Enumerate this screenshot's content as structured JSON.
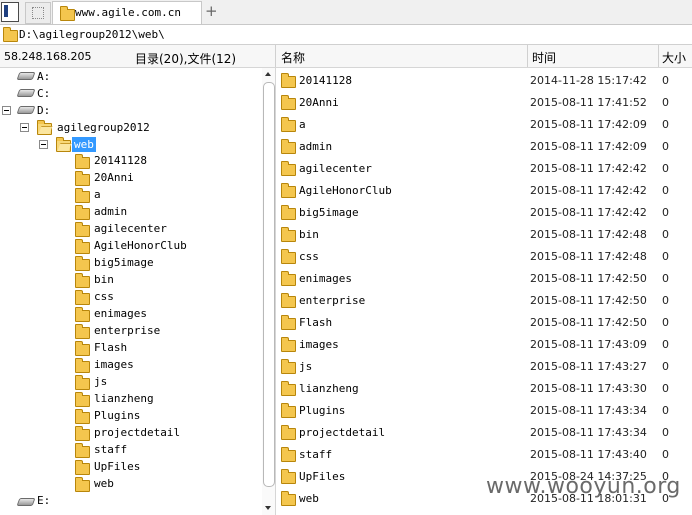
{
  "tabs": [
    {
      "label": "www.agile.com.cn"
    }
  ],
  "new_tab_label": "+",
  "path": "D:\\agilegroup2012\\web\\",
  "status": {
    "ip": "58.248.168.205",
    "summary": "目录(20),文件(12)"
  },
  "columns": {
    "name": "名称",
    "time": "时间",
    "size": "大小"
  },
  "tree": {
    "drives_top": [
      "A:",
      "C:",
      "D:"
    ],
    "agilegroup": "agilegroup2012",
    "web": "web",
    "children": [
      "20141128",
      "20Anni",
      "a",
      "admin",
      "agilecenter",
      "AgileHonorClub",
      "big5image",
      "bin",
      "css",
      "enimages",
      "enterprise",
      "Flash",
      "images",
      "js",
      "lianzheng",
      "Plugins",
      "projectdetail",
      "staff",
      "UpFiles",
      "web"
    ],
    "drive_e": "E:"
  },
  "files": [
    {
      "name": "20141128",
      "time": "2014-11-28 15:17:42",
      "size": "0"
    },
    {
      "name": "20Anni",
      "time": "2015-08-11 17:41:52",
      "size": "0"
    },
    {
      "name": "a",
      "time": "2015-08-11 17:42:09",
      "size": "0"
    },
    {
      "name": "admin",
      "time": "2015-08-11 17:42:09",
      "size": "0"
    },
    {
      "name": "agilecenter",
      "time": "2015-08-11 17:42:42",
      "size": "0"
    },
    {
      "name": "AgileHonorClub",
      "time": "2015-08-11 17:42:42",
      "size": "0"
    },
    {
      "name": "big5image",
      "time": "2015-08-11 17:42:42",
      "size": "0"
    },
    {
      "name": "bin",
      "time": "2015-08-11 17:42:48",
      "size": "0"
    },
    {
      "name": "css",
      "time": "2015-08-11 17:42:48",
      "size": "0"
    },
    {
      "name": "enimages",
      "time": "2015-08-11 17:42:50",
      "size": "0"
    },
    {
      "name": "enterprise",
      "time": "2015-08-11 17:42:50",
      "size": "0"
    },
    {
      "name": "Flash",
      "time": "2015-08-11 17:42:50",
      "size": "0"
    },
    {
      "name": "images",
      "time": "2015-08-11 17:43:09",
      "size": "0"
    },
    {
      "name": "js",
      "time": "2015-08-11 17:43:27",
      "size": "0"
    },
    {
      "name": "lianzheng",
      "time": "2015-08-11 17:43:30",
      "size": "0"
    },
    {
      "name": "Plugins",
      "time": "2015-08-11 17:43:34",
      "size": "0"
    },
    {
      "name": "projectdetail",
      "time": "2015-08-11 17:43:34",
      "size": "0"
    },
    {
      "name": "staff",
      "time": "2015-08-11 17:43:40",
      "size": "0"
    },
    {
      "name": "UpFiles",
      "time": "2015-08-24 14:37:25",
      "size": "0"
    },
    {
      "name": "web",
      "time": "2015-08-11 18:01:31",
      "size": "0"
    }
  ],
  "watermark": "www.wooyun.org",
  "colors": {
    "selection": "#3399ff",
    "header_bg": "#f4f4f4",
    "time_text": "#222222"
  }
}
